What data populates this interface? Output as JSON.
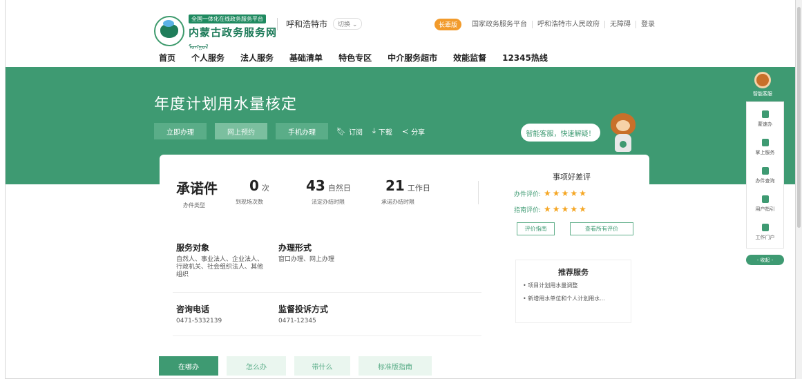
{
  "header": {
    "logo_tag": "全国一体化在线政务服务平台",
    "logo_title": "内蒙古政务服务网",
    "logo_mongolian": "ᠮᠣᠩᠭᠣᠯ",
    "city": "呼和浩特市",
    "switch_label": "切换",
    "elder_badge": "长辈版",
    "links": [
      "国家政务服务平台",
      "呼和浩特市人民政府",
      "无障碍",
      "登录"
    ]
  },
  "nav": [
    "首页",
    "个人服务",
    "法人服务",
    "基础清单",
    "特色专区",
    "中介服务超市",
    "效能监督",
    "12345热线"
  ],
  "banner": {
    "title": "年度计划用水量核定",
    "buttons": [
      "立即办理",
      "网上预约",
      "手机办理"
    ],
    "actions": [
      "订阅",
      "下载",
      "分享"
    ],
    "assistant_bubble": "智能客服，快速解疑！"
  },
  "stats": [
    {
      "value": "承诺件",
      "unit": "",
      "caption": "办件类型"
    },
    {
      "value": "0",
      "unit": "次",
      "caption": "到现场次数"
    },
    {
      "value": "43",
      "unit": "自然日",
      "caption": "法定办结时限"
    },
    {
      "value": "21",
      "unit": "工作日",
      "caption": "承诺办结时限"
    }
  ],
  "review": {
    "title": "事项好差评",
    "handling_label": "办件评价:",
    "guide_label": "指南评价:",
    "stars": "★★★★★",
    "btn_guide": "评价指南",
    "btn_all": "查看所有评价"
  },
  "details": {
    "service_target_title": "服务对象",
    "service_target_text": [
      "自然人、事业法人、企业法人、",
      "行政机关、社会组织法人、其他",
      "组织"
    ],
    "handling_form_title": "办理形式",
    "handling_form_text": "窗口办理、网上办理",
    "phone_title": "咨询电话",
    "phone_value": "0471-5332139",
    "complaint_title": "监督投诉方式",
    "complaint_value": "0471-12345"
  },
  "recommend": {
    "title": "推荐服务",
    "items": [
      "• 项目计划用水量调整",
      "• 新增用水单位和个人计划用水..."
    ]
  },
  "tabs": [
    "在哪办",
    "怎么办",
    "带什么",
    "标准版指南"
  ],
  "side": {
    "assistant": "智能客服",
    "items": [
      "蒙速办",
      "掌上服务",
      "办件查询",
      "用户指引",
      "工作门户"
    ],
    "collapse": "- 收起 -"
  },
  "colors": {
    "brand": "#3e9a72",
    "star": "#f5a623",
    "elder": "#f29b2c"
  }
}
